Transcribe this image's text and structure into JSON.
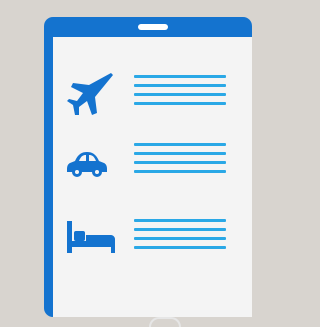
{
  "illustration": {
    "device": "tablet",
    "rows": [
      {
        "icon": "airplane-icon",
        "lines": 4
      },
      {
        "icon": "car-icon",
        "lines": 4
      },
      {
        "icon": "bed-icon",
        "lines": 4
      }
    ]
  },
  "colors": {
    "background": "#d8d4cf",
    "frame": "#1473cf",
    "screen": "#f4f4f4",
    "icon": "#1473cf",
    "text_lines": "#2aa8e6"
  }
}
